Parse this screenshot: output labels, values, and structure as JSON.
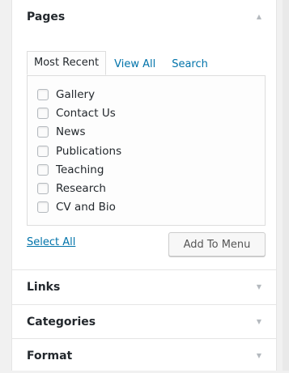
{
  "pages_section": {
    "title": "Pages",
    "tabs": [
      "Most Recent",
      "View All",
      "Search"
    ],
    "items": [
      "Gallery",
      "Contact Us",
      "News",
      "Publications",
      "Teaching",
      "Research",
      "CV and Bio"
    ],
    "select_all": "Select All",
    "add_button": "Add To Menu"
  },
  "sections": [
    {
      "title": "Links"
    },
    {
      "title": "Categories"
    },
    {
      "title": "Format"
    }
  ],
  "icons": {
    "expanded": "arrow-up-icon",
    "collapsed": "arrow-down-icon"
  },
  "colors": {
    "link": "#0073aa",
    "panel_bg": "#ffffff",
    "border": "#dddddd"
  }
}
